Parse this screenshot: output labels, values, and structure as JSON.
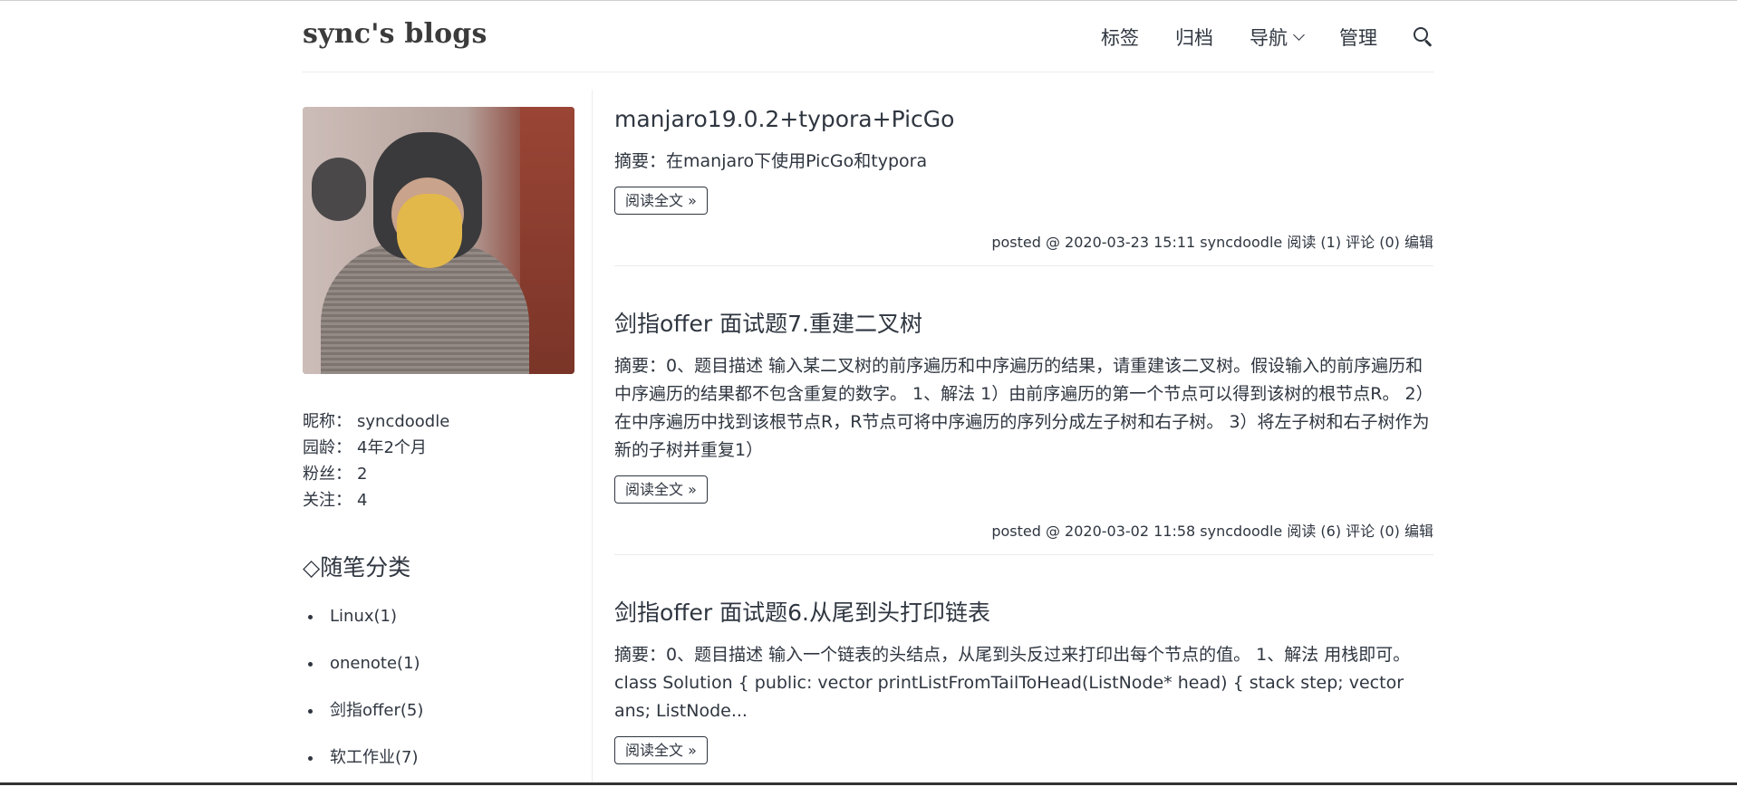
{
  "site": {
    "title": "sync's blogs"
  },
  "nav": {
    "tags": "标签",
    "archive": "归档",
    "navigate": "导航",
    "manage": "管理"
  },
  "profile": {
    "nickname_label": "昵称：",
    "nickname": "syncdoodle",
    "age_label": "园龄：",
    "age": "4年2个月",
    "fans_label": "粉丝：",
    "fans": "2",
    "follow_label": "关注：",
    "follow": "4"
  },
  "categories": {
    "title": "◇随笔分类",
    "items": [
      {
        "label": "Linux(1)"
      },
      {
        "label": "onenote(1)"
      },
      {
        "label": "剑指offer(5)"
      },
      {
        "label": "软工作业(7)"
      }
    ]
  },
  "posts": [
    {
      "title": "manjaro19.0.2+typora+PicGo",
      "summary": "摘要：在manjaro下使用PicGo和typora",
      "read_more": "阅读全文 »",
      "meta": "posted @ 2020-03-23 15:11 syncdoodle 阅读 (1) 评论 (0) 编辑"
    },
    {
      "title": "剑指offer 面试题7.重建二叉树",
      "summary": "摘要：0、题目描述 输入某二叉树的前序遍历和中序遍历的结果，请重建该二叉树。假设输入的前序遍历和中序遍历的结果都不包含重复的数字。 1、解法 1）由前序遍历的第一个节点可以得到该树的根节点R。 2）在中序遍历中找到该根节点R，R节点可将中序遍历的序列分成左子树和右子树。 3）将左子树和右子树作为新的子树并重复1）",
      "read_more": "阅读全文 »",
      "meta": "posted @ 2020-03-02 11:58 syncdoodle 阅读 (6) 评论 (0) 编辑"
    },
    {
      "title": "剑指offer 面试题6.从尾到头打印链表",
      "summary": "摘要：0、题目描述 输入一个链表的头结点，从尾到头反过来打印出每个节点的值。 1、解法 用栈即可。 class Solution { public: vector printListFromTailToHead(ListNode* head) { stack step; vector ans; ListNode...",
      "read_more": "阅读全文 »"
    }
  ]
}
